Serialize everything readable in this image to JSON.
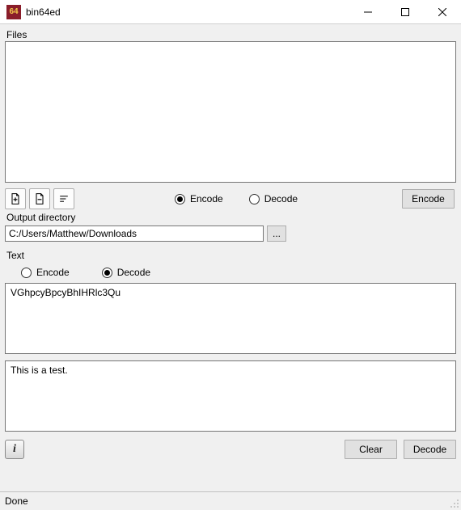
{
  "window": {
    "icon_text": "64",
    "title": "bin64ed"
  },
  "files": {
    "label": "Files",
    "radio_encode": "Encode",
    "radio_decode": "Decode",
    "selected": "encode",
    "action_button": "Encode"
  },
  "output": {
    "label": "Output directory",
    "path": "C:/Users/Matthew/Downloads",
    "browse": "..."
  },
  "text": {
    "label": "Text",
    "radio_encode": "Encode",
    "radio_decode": "Decode",
    "selected": "decode",
    "input": "VGhpcyBpcyBhIHRlc3Qu",
    "output": "This is a test.",
    "clear_button": "Clear",
    "action_button": "Decode"
  },
  "status": "Done"
}
